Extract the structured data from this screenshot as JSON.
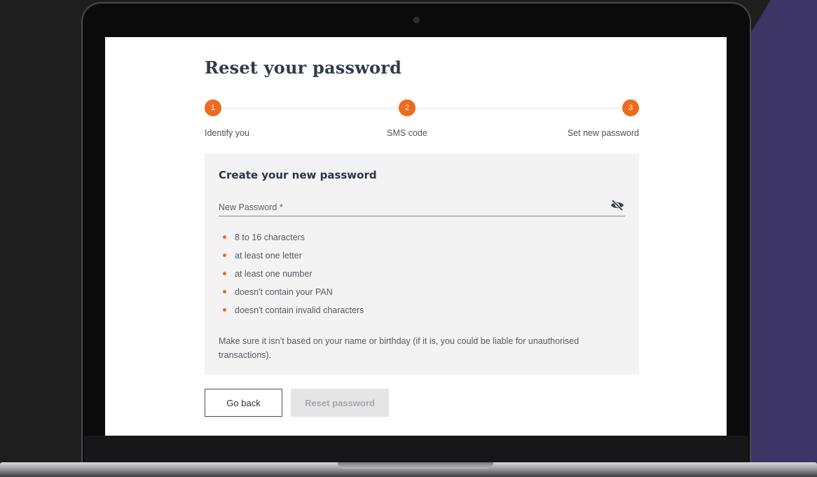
{
  "page": {
    "title": "Reset your password"
  },
  "stepper": {
    "steps": [
      {
        "number": "1",
        "label": "Identify you"
      },
      {
        "number": "2",
        "label": "SMS code"
      },
      {
        "number": "3",
        "label": "Set new password"
      }
    ],
    "accent_color": "#ee6a1f"
  },
  "form": {
    "heading": "Create your new password",
    "password_field": {
      "placeholder": "New Password *",
      "value": "",
      "toggle_icon": "eye-slash-icon"
    },
    "requirements": [
      "8 to 16 characters",
      "at least one letter",
      "at least one number",
      "doesn't contain your PAN",
      "doesn't contain invalid characters"
    ],
    "note": "Make sure it isn’t based on your name or birthday (if it is, you could be liable for unauthorised transactions)."
  },
  "actions": {
    "back_label": "Go back",
    "reset_label": "Reset password",
    "reset_disabled": true
  }
}
